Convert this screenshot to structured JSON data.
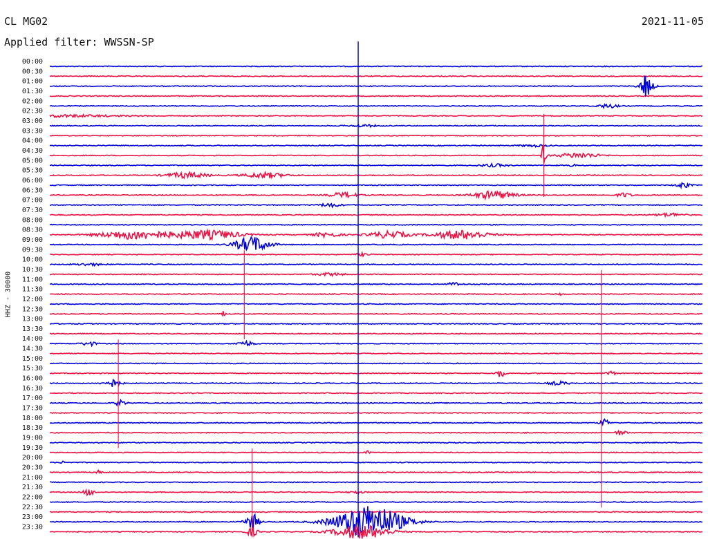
{
  "header": {
    "station": "CL MG02",
    "date": "2021-11-05",
    "filter": "Applied filter: WWSSN-SP"
  },
  "chart_data": {
    "type": "line",
    "title": "CL MG02",
    "subtitle": "Applied filter: WWSSN-SP",
    "date": "2021-11-05",
    "ylabel": "HHZ - 30000",
    "xlabel": "",
    "row_labels": [
      "00:00",
      "00:30",
      "01:00",
      "01:30",
      "02:00",
      "02:30",
      "03:00",
      "03:30",
      "04:00",
      "04:30",
      "05:00",
      "05:30",
      "06:00",
      "06:30",
      "07:00",
      "07:30",
      "08:00",
      "08:30",
      "09:00",
      "09:30",
      "10:00",
      "10:30",
      "11:00",
      "11:30",
      "12:00",
      "12:30",
      "13:00",
      "13:30",
      "14:00",
      "14:30",
      "15:00",
      "15:30",
      "16:00",
      "16:30",
      "17:00",
      "17:30",
      "18:00",
      "18:30",
      "19:00",
      "19:30",
      "20:00",
      "20:30",
      "21:00",
      "21:30",
      "22:00",
      "22:30",
      "23:00",
      "23:30"
    ],
    "trace_colors": [
      "#0000dd",
      "#ee1144"
    ],
    "events": [
      {
        "row": 2,
        "t": 0.913,
        "amp": 3.2,
        "dur": 0.005,
        "spike": 30
      },
      {
        "row": 2,
        "t": 0.915,
        "amp": 1.6,
        "dur": 0.012,
        "spike": 0
      },
      {
        "row": 4,
        "t": 0.855,
        "amp": 0.7,
        "dur": 0.015,
        "spike": 0
      },
      {
        "row": 5,
        "t": 0.005,
        "amp": 0.4,
        "dur": 0.1,
        "spike": 0
      },
      {
        "row": 6,
        "t": 0.48,
        "amp": 0.4,
        "dur": 0.02,
        "spike": 0
      },
      {
        "row": 8,
        "t": 0.74,
        "amp": 0.35,
        "dur": 0.02,
        "spike": 0
      },
      {
        "row": 9,
        "t": 0.757,
        "amp": 4.5,
        "dur": 0.003,
        "spike": 120
      },
      {
        "row": 9,
        "t": 0.81,
        "amp": 0.9,
        "dur": 0.03,
        "spike": 0
      },
      {
        "row": 10,
        "t": 0.68,
        "amp": 0.5,
        "dur": 0.02,
        "spike": 0
      },
      {
        "row": 10,
        "t": 0.8,
        "amp": 0.6,
        "dur": 0.005,
        "spike": 0
      },
      {
        "row": 11,
        "t": 0.21,
        "amp": 1.0,
        "dur": 0.03,
        "spike": 0
      },
      {
        "row": 11,
        "t": 0.33,
        "amp": 1.0,
        "dur": 0.03,
        "spike": 0
      },
      {
        "row": 12,
        "t": 0.97,
        "amp": 1.0,
        "dur": 0.01,
        "spike": 0
      },
      {
        "row": 13,
        "t": 0.45,
        "amp": 0.9,
        "dur": 0.02,
        "spike": 0
      },
      {
        "row": 13,
        "t": 0.68,
        "amp": 1.5,
        "dur": 0.03,
        "spike": 0
      },
      {
        "row": 13,
        "t": 0.88,
        "amp": 0.8,
        "dur": 0.01,
        "spike": 0
      },
      {
        "row": 14,
        "t": 0.43,
        "amp": 0.7,
        "dur": 0.015,
        "spike": 0
      },
      {
        "row": 15,
        "t": 0.95,
        "amp": 0.6,
        "dur": 0.02,
        "spike": 0
      },
      {
        "row": 17,
        "t": 0.13,
        "amp": 1.6,
        "dur": 0.05,
        "spike": 0
      },
      {
        "row": 17,
        "t": 0.24,
        "amp": 1.6,
        "dur": 0.05,
        "spike": 0
      },
      {
        "row": 17,
        "t": 0.425,
        "amp": 0.8,
        "dur": 0.02,
        "spike": 0
      },
      {
        "row": 17,
        "t": 0.52,
        "amp": 1.2,
        "dur": 0.03,
        "spike": 0
      },
      {
        "row": 17,
        "t": 0.63,
        "amp": 1.6,
        "dur": 0.04,
        "spike": 0
      },
      {
        "row": 18,
        "t": 0.31,
        "amp": 2.8,
        "dur": 0.025,
        "spike": 0
      },
      {
        "row": 19,
        "t": 0.48,
        "amp": 0.5,
        "dur": 0.01,
        "spike": 0
      },
      {
        "row": 20,
        "t": 0.06,
        "amp": 0.4,
        "dur": 0.02,
        "spike": 0
      },
      {
        "row": 21,
        "t": 0.43,
        "amp": 0.5,
        "dur": 0.02,
        "spike": 0
      },
      {
        "row": 22,
        "t": 0.62,
        "amp": 0.6,
        "dur": 0.01,
        "spike": 0
      },
      {
        "row": 23,
        "t": 0.781,
        "amp": 0.8,
        "dur": 0.003,
        "spike": 0
      },
      {
        "row": 25,
        "t": 0.266,
        "amp": 1.0,
        "dur": 0.003,
        "spike": 0
      },
      {
        "row": 28,
        "t": 0.06,
        "amp": 0.8,
        "dur": 0.01,
        "spike": 0
      },
      {
        "row": 28,
        "t": 0.3,
        "amp": 0.9,
        "dur": 0.012,
        "spike": 0
      },
      {
        "row": 31,
        "t": 0.69,
        "amp": 1.5,
        "dur": 0.006,
        "spike": 0
      },
      {
        "row": 31,
        "t": 0.858,
        "amp": 0.8,
        "dur": 0.008,
        "spike": 0
      },
      {
        "row": 32,
        "t": 0.095,
        "amp": 1.4,
        "dur": 0.012,
        "spike": 0
      },
      {
        "row": 32,
        "t": 0.78,
        "amp": 0.6,
        "dur": 0.015,
        "spike": 0
      },
      {
        "row": 34,
        "t": 0.108,
        "amp": 1.0,
        "dur": 0.008,
        "spike": 0
      },
      {
        "row": 36,
        "t": 0.85,
        "amp": 1.6,
        "dur": 0.006,
        "spike": 0
      },
      {
        "row": 37,
        "t": 0.875,
        "amp": 0.8,
        "dur": 0.008,
        "spike": 0
      },
      {
        "row": 39,
        "t": 0.486,
        "amp": 0.6,
        "dur": 0.004,
        "spike": 0
      },
      {
        "row": 40,
        "t": 0.02,
        "amp": 0.5,
        "dur": 0.003,
        "spike": 0
      },
      {
        "row": 41,
        "t": 0.075,
        "amp": 0.6,
        "dur": 0.004,
        "spike": 0
      },
      {
        "row": 43,
        "t": 0.06,
        "amp": 1.2,
        "dur": 0.008,
        "spike": 0
      },
      {
        "row": 43,
        "t": 0.47,
        "amp": 0.5,
        "dur": 0.01,
        "spike": 0
      },
      {
        "row": 46,
        "t": 0.31,
        "amp": 3.0,
        "dur": 0.01,
        "spike": 0
      },
      {
        "row": 46,
        "t": 0.49,
        "amp": 6.0,
        "dur": 0.05,
        "spike": 0
      },
      {
        "row": 47,
        "t": 0.31,
        "amp": 1.6,
        "dur": 0.008,
        "spike": 0
      },
      {
        "row": 47,
        "t": 0.478,
        "amp": 2.5,
        "dur": 0.04,
        "spike": 0
      }
    ],
    "long_spikes": [
      {
        "t": 0.4725,
        "from_row": 0,
        "to_row": 47
      },
      {
        "t": 0.845,
        "from_row": 21,
        "to_row": 44
      },
      {
        "t": 0.298,
        "from_row": 19,
        "to_row": 27
      },
      {
        "t": 0.105,
        "from_row": 28,
        "to_row": 38
      },
      {
        "t": 0.31,
        "from_row": 39,
        "to_row": 47
      }
    ]
  }
}
